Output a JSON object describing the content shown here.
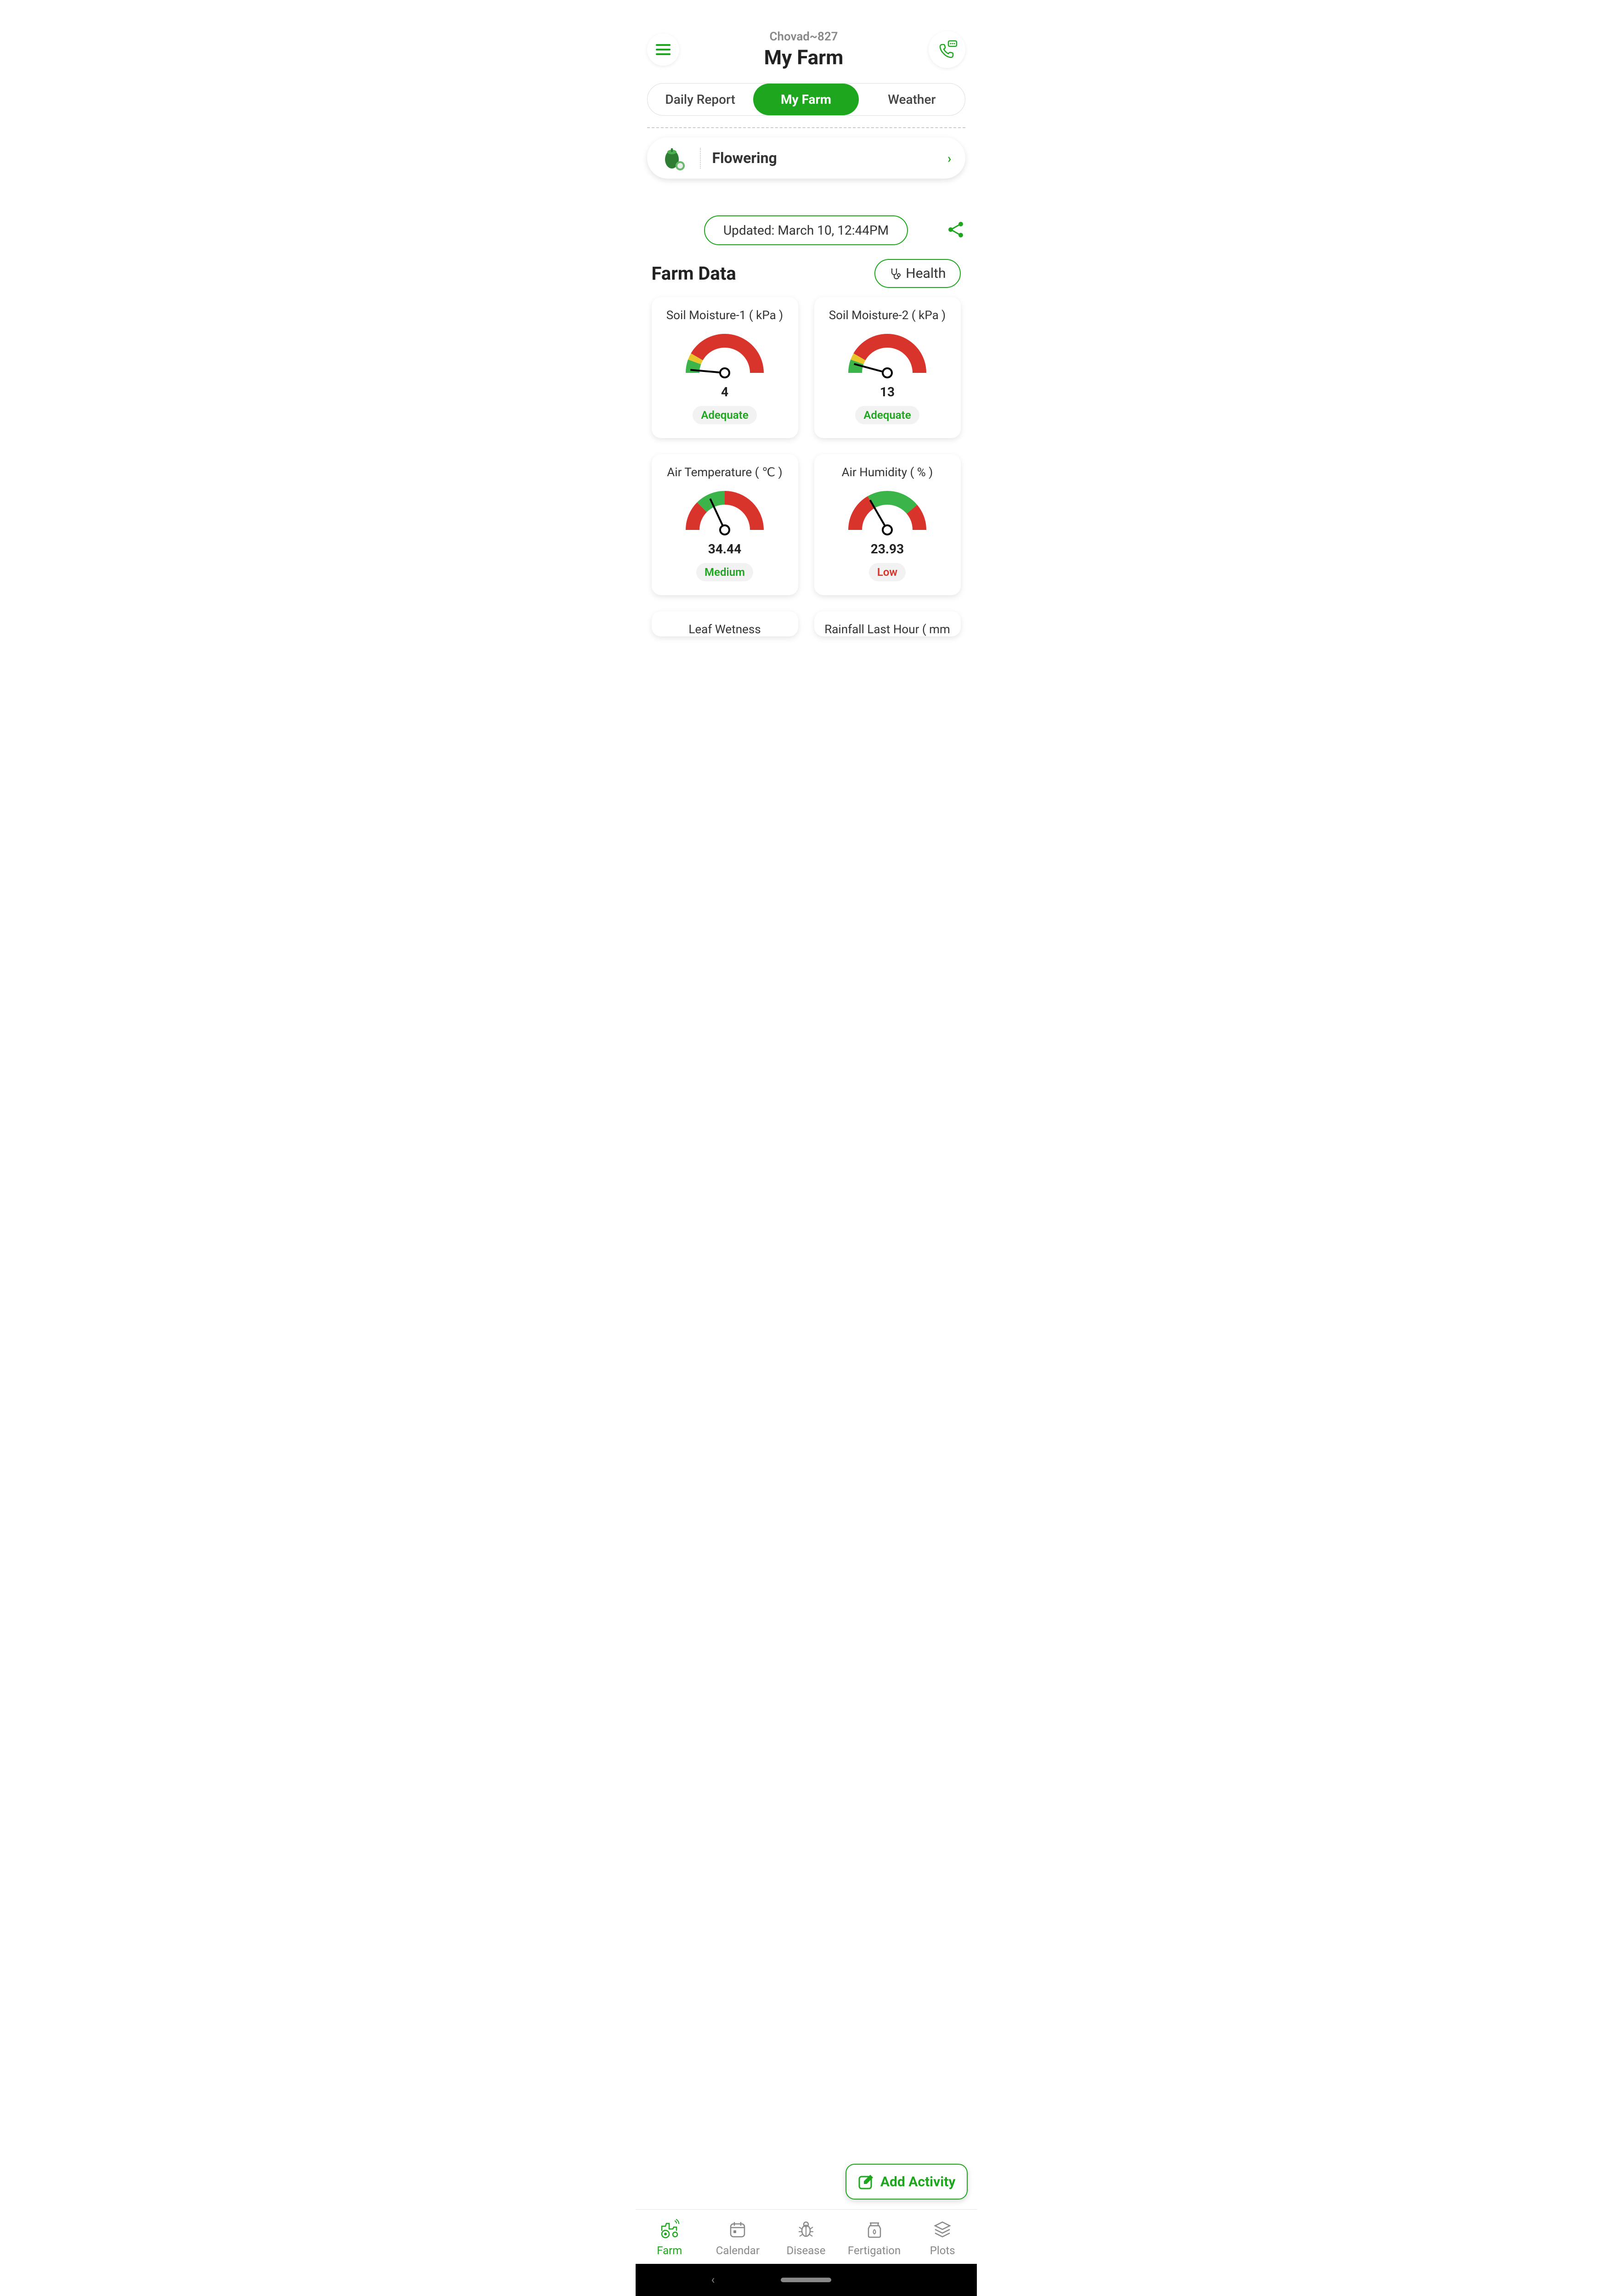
{
  "header": {
    "farm_code": "Chovad~827",
    "title": "My Farm"
  },
  "tabs": {
    "daily_report": "Daily Report",
    "my_farm": "My Farm",
    "weather": "Weather"
  },
  "crop": {
    "stage": "Flowering"
  },
  "updated_label": "Updated: March 10, 12:44PM",
  "section": {
    "title": "Farm Data",
    "health_label": "Health"
  },
  "gauges": [
    {
      "title": "Soil Moisture-1 ( kPa )",
      "value": "4",
      "status": "Adequate",
      "status_color": "green",
      "needle_angle": -175,
      "arc": "A"
    },
    {
      "title": "Soil Moisture-2 ( kPa )",
      "value": "13",
      "status": "Adequate",
      "status_color": "green",
      "needle_angle": -165,
      "arc": "A"
    },
    {
      "title": "Air Temperature ( ℃ )",
      "value": "34.44",
      "status": "Medium",
      "status_color": "green",
      "needle_angle": -115,
      "arc": "B"
    },
    {
      "title": "Air Humidity ( % )",
      "value": "23.93",
      "status": "Low",
      "status_color": "red",
      "needle_angle": -120,
      "arc": "C"
    }
  ],
  "partial_gauges": [
    {
      "title": "Leaf Wetness"
    },
    {
      "title": "Rainfall Last Hour ( mm )"
    }
  ],
  "add_activity_label": "Add Activity",
  "nav": {
    "farm": "Farm",
    "calendar": "Calendar",
    "disease": "Disease",
    "fertigation": "Fertigation",
    "plots": "Plots"
  },
  "colors": {
    "brand": "#1ea71e",
    "danger": "#d9342b"
  }
}
